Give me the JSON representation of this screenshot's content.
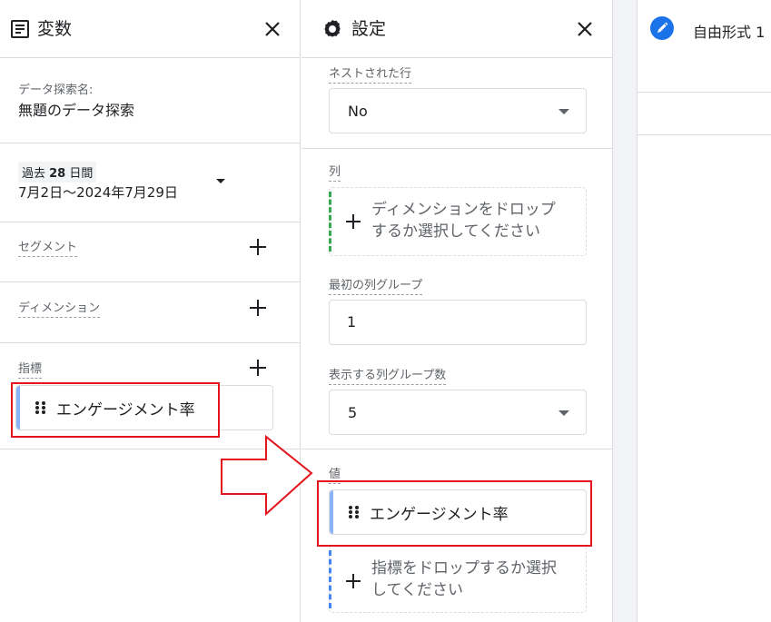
{
  "variables_panel": {
    "title": "変数",
    "exploration_name_label": "データ探索名:",
    "exploration_name": "無題のデータ探索",
    "date_range": {
      "preset_prefix": "過去 ",
      "preset_number": "28",
      "preset_suffix": " 日間",
      "range": "7月2日～2024年7月29日"
    },
    "segments_label": "セグメント",
    "dimensions_label": "ディメンション",
    "metrics_label": "指標",
    "metric_chip": "エンゲージメント率"
  },
  "settings_panel": {
    "title": "設定",
    "nested_rows_label": "ネストされた行",
    "nested_rows_value": "No",
    "columns_label": "列",
    "columns_drop_line1": "ディメンションをドロップ",
    "columns_drop_line2": "するか選択してください",
    "first_col_group_label": "最初の列グループ",
    "first_col_group_value": "1",
    "show_col_groups_label": "表示する列グループ数",
    "show_col_groups_value": "5",
    "values_label": "値",
    "values_chip": "エンゲージメント率",
    "values_drop_line1": "指標をドロップするか選択",
    "values_drop_line2": "してください"
  },
  "canvas": {
    "tab_title": "自由形式 1"
  },
  "colors": {
    "accent": "#1a73e8",
    "highlight": "#e3141b",
    "chip_bar": "#8ab4f8"
  },
  "icons": [
    "list-icon",
    "gear-icon",
    "close-icon",
    "plus-icon",
    "drag-handle-icon",
    "pencil-icon",
    "dropdown-caret-icon",
    "right-arrow-icon"
  ]
}
